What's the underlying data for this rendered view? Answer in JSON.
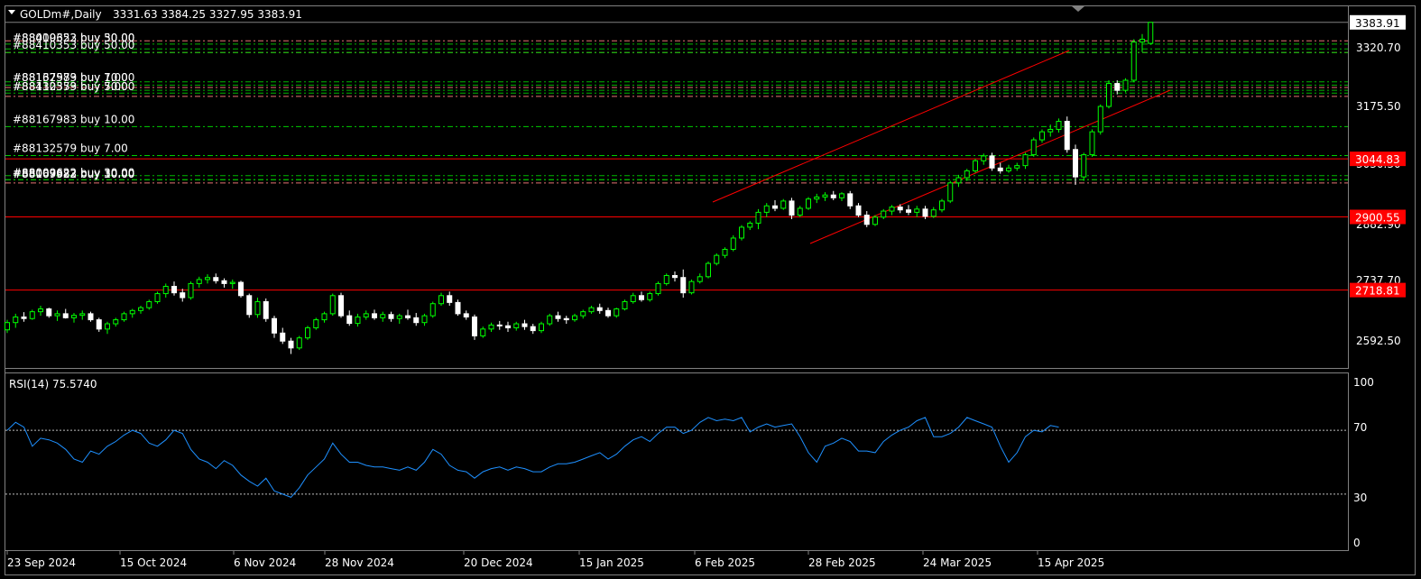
{
  "header": {
    "symbol": "GOLDm#,Daily",
    "ohlc": "3331.63 3384.25 3327.95 3383.91"
  },
  "price_axis": {
    "labels": [
      "3320.70",
      "3175.50",
      "3030.30",
      "2882.90",
      "2737.70",
      "2592.50"
    ],
    "current_price": "3383.91",
    "red_tags": [
      "3044.83",
      "2900.55",
      "2718.81"
    ]
  },
  "rsi": {
    "title": "RSI(14) 75.5740",
    "levels": [
      "100",
      "70",
      "30",
      "0"
    ]
  },
  "date_labels": [
    "23 Sep 2024",
    "15 Oct 2024",
    "6 Nov 2024",
    "28 Nov 2024",
    "20 Dec 2024",
    "15 Jan 2025",
    "6 Feb 2025",
    "28 Feb 2025",
    "24 Mar 2025",
    "15 Apr 2025"
  ],
  "orders": [
    {
      "text": "#88167983 buy 10.00",
      "price": 3125
    },
    {
      "text": "#88132579 buy 7.00",
      "price": 3053
    },
    {
      "text": "#88410353 buy 50.00",
      "price": 3309
    },
    {
      "text": "#88009622 buy 30.00",
      "price": 2993
    }
  ],
  "colors": {
    "bull": "#00ff00",
    "bear": "#ffffff",
    "sr_line": "#ff0000",
    "channel": "#ff0000",
    "rsi_line": "#1e90ff",
    "order_line": "#00cc00",
    "frame": "#808080"
  },
  "chart_data": {
    "type": "candlestick",
    "ylim": [
      2570,
      3410
    ],
    "series": [
      {
        "name": "GOLDm#,Daily",
        "values": [
          [
            2620,
            2645,
            2612,
            2638
          ],
          [
            2638,
            2660,
            2625,
            2652
          ],
          [
            2652,
            2664,
            2640,
            2648
          ],
          [
            2648,
            2670,
            2645,
            2665
          ],
          [
            2665,
            2680,
            2655,
            2672
          ],
          [
            2672,
            2675,
            2650,
            2655
          ],
          [
            2655,
            2668,
            2642,
            2660
          ],
          [
            2660,
            2672,
            2648,
            2650
          ],
          [
            2650,
            2662,
            2638,
            2656
          ],
          [
            2656,
            2668,
            2645,
            2660
          ],
          [
            2660,
            2665,
            2640,
            2645
          ],
          [
            2645,
            2650,
            2615,
            2622
          ],
          [
            2622,
            2640,
            2610,
            2635
          ],
          [
            2635,
            2650,
            2628,
            2645
          ],
          [
            2645,
            2665,
            2640,
            2660
          ],
          [
            2660,
            2672,
            2650,
            2668
          ],
          [
            2668,
            2680,
            2660,
            2675
          ],
          [
            2675,
            2695,
            2670,
            2690
          ],
          [
            2690,
            2715,
            2685,
            2710
          ],
          [
            2710,
            2735,
            2700,
            2728
          ],
          [
            2728,
            2740,
            2705,
            2712
          ],
          [
            2712,
            2722,
            2690,
            2700
          ],
          [
            2700,
            2740,
            2695,
            2735
          ],
          [
            2735,
            2752,
            2725,
            2745
          ],
          [
            2745,
            2758,
            2735,
            2750
          ],
          [
            2750,
            2760,
            2735,
            2742
          ],
          [
            2742,
            2748,
            2725,
            2735
          ],
          [
            2735,
            2745,
            2722,
            2738
          ],
          [
            2738,
            2742,
            2700,
            2705
          ],
          [
            2705,
            2710,
            2650,
            2658
          ],
          [
            2658,
            2700,
            2650,
            2690
          ],
          [
            2690,
            2698,
            2640,
            2648
          ],
          [
            2648,
            2655,
            2600,
            2612
          ],
          [
            2612,
            2625,
            2585,
            2592
          ],
          [
            2592,
            2600,
            2560,
            2575
          ],
          [
            2575,
            2605,
            2570,
            2600
          ],
          [
            2600,
            2630,
            2595,
            2625
          ],
          [
            2625,
            2650,
            2620,
            2645
          ],
          [
            2645,
            2665,
            2638,
            2660
          ],
          [
            2660,
            2710,
            2655,
            2705
          ],
          [
            2705,
            2712,
            2650,
            2655
          ],
          [
            2655,
            2668,
            2630,
            2636
          ],
          [
            2636,
            2660,
            2628,
            2652
          ],
          [
            2652,
            2668,
            2645,
            2660
          ],
          [
            2660,
            2670,
            2645,
            2650
          ],
          [
            2650,
            2665,
            2640,
            2658
          ],
          [
            2658,
            2665,
            2640,
            2648
          ],
          [
            2648,
            2660,
            2635,
            2655
          ],
          [
            2655,
            2670,
            2645,
            2650
          ],
          [
            2650,
            2662,
            2630,
            2638
          ],
          [
            2638,
            2660,
            2630,
            2655
          ],
          [
            2655,
            2690,
            2650,
            2685
          ],
          [
            2685,
            2712,
            2680,
            2705
          ],
          [
            2705,
            2715,
            2680,
            2688
          ],
          [
            2688,
            2695,
            2655,
            2660
          ],
          [
            2660,
            2668,
            2645,
            2652
          ],
          [
            2652,
            2658,
            2595,
            2605
          ],
          [
            2605,
            2628,
            2600,
            2622
          ],
          [
            2622,
            2638,
            2615,
            2632
          ],
          [
            2632,
            2642,
            2620,
            2630
          ],
          [
            2630,
            2640,
            2615,
            2625
          ],
          [
            2625,
            2640,
            2618,
            2635
          ],
          [
            2635,
            2645,
            2620,
            2628
          ],
          [
            2628,
            2635,
            2610,
            2618
          ],
          [
            2618,
            2640,
            2612,
            2635
          ],
          [
            2635,
            2660,
            2630,
            2655
          ],
          [
            2655,
            2665,
            2640,
            2648
          ],
          [
            2648,
            2655,
            2635,
            2645
          ],
          [
            2645,
            2660,
            2640,
            2655
          ],
          [
            2655,
            2670,
            2648,
            2665
          ],
          [
            2665,
            2680,
            2660,
            2675
          ],
          [
            2675,
            2685,
            2660,
            2668
          ],
          [
            2668,
            2675,
            2650,
            2655
          ],
          [
            2655,
            2675,
            2650,
            2672
          ],
          [
            2672,
            2695,
            2668,
            2690
          ],
          [
            2690,
            2712,
            2685,
            2705
          ],
          [
            2705,
            2715,
            2690,
            2695
          ],
          [
            2695,
            2715,
            2690,
            2710
          ],
          [
            2710,
            2740,
            2705,
            2735
          ],
          [
            2735,
            2760,
            2730,
            2755
          ],
          [
            2755,
            2765,
            2740,
            2750
          ],
          [
            2750,
            2770,
            2700,
            2712
          ],
          [
            2712,
            2745,
            2708,
            2740
          ],
          [
            2740,
            2760,
            2735,
            2752
          ],
          [
            2752,
            2790,
            2748,
            2785
          ],
          [
            2785,
            2810,
            2780,
            2805
          ],
          [
            2805,
            2825,
            2798,
            2820
          ],
          [
            2820,
            2855,
            2815,
            2848
          ],
          [
            2848,
            2880,
            2842,
            2875
          ],
          [
            2875,
            2890,
            2868,
            2885
          ],
          [
            2885,
            2920,
            2870,
            2912
          ],
          [
            2912,
            2935,
            2900,
            2928
          ],
          [
            2928,
            2942,
            2915,
            2922
          ],
          [
            2922,
            2945,
            2918,
            2940
          ],
          [
            2940,
            2948,
            2895,
            2905
          ],
          [
            2905,
            2928,
            2900,
            2922
          ],
          [
            2922,
            2950,
            2918,
            2945
          ],
          [
            2945,
            2958,
            2935,
            2950
          ],
          [
            2950,
            2962,
            2940,
            2955
          ],
          [
            2955,
            2965,
            2942,
            2948
          ],
          [
            2948,
            2962,
            2940,
            2958
          ],
          [
            2958,
            2965,
            2920,
            2928
          ],
          [
            2928,
            2935,
            2900,
            2905
          ],
          [
            2905,
            2915,
            2875,
            2882
          ],
          [
            2882,
            2905,
            2878,
            2900
          ],
          [
            2900,
            2920,
            2895,
            2915
          ],
          [
            2915,
            2930,
            2905,
            2925
          ],
          [
            2925,
            2932,
            2910,
            2918
          ],
          [
            2918,
            2930,
            2905,
            2912
          ],
          [
            2912,
            2928,
            2900,
            2920
          ],
          [
            2920,
            2928,
            2895,
            2902
          ],
          [
            2902,
            2925,
            2898,
            2918
          ],
          [
            2918,
            2945,
            2912,
            2940
          ],
          [
            2940,
            2990,
            2935,
            2985
          ],
          [
            2985,
            3005,
            2975,
            2998
          ],
          [
            2998,
            3020,
            2990,
            3015
          ],
          [
            3015,
            3045,
            3010,
            3040
          ],
          [
            3040,
            3058,
            3030,
            3052
          ],
          [
            3052,
            3060,
            3015,
            3022
          ],
          [
            3022,
            3035,
            3008,
            3015
          ],
          [
            3015,
            3030,
            3010,
            3022
          ],
          [
            3022,
            3035,
            3015,
            3028
          ],
          [
            3028,
            3060,
            3020,
            3055
          ],
          [
            3055,
            3098,
            3050,
            3092
          ],
          [
            3092,
            3118,
            3085,
            3112
          ],
          [
            3112,
            3130,
            3100,
            3118
          ],
          [
            3118,
            3145,
            3110,
            3138
          ],
          [
            3138,
            3150,
            3060,
            3068
          ],
          [
            3068,
            3080,
            2980,
            3000
          ],
          [
            3000,
            3060,
            2990,
            3055
          ],
          [
            3055,
            3118,
            3050,
            3112
          ],
          [
            3112,
            3180,
            3105,
            3175
          ],
          [
            3175,
            3240,
            3170,
            3232
          ],
          [
            3232,
            3240,
            3205,
            3215
          ],
          [
            3215,
            3245,
            3210,
            3240
          ],
          [
            3240,
            3342,
            3235,
            3335
          ],
          [
            3335,
            3355,
            3310,
            3342
          ],
          [
            3331.63,
            3384.25,
            3327.95,
            3383.91
          ]
        ]
      },
      {
        "name": "RSI(14)",
        "values": [
          70,
          75,
          72,
          60,
          65,
          64,
          62,
          58,
          52,
          50,
          57,
          55,
          60,
          63,
          67,
          70,
          68,
          62,
          60,
          64,
          70,
          68,
          58,
          52,
          50,
          46,
          51,
          48,
          42,
          38,
          35,
          40,
          32,
          30,
          28,
          34,
          42,
          47,
          52,
          62,
          55,
          50,
          50,
          48,
          47,
          47,
          46,
          45,
          47,
          45,
          50,
          58,
          55,
          48,
          45,
          44,
          40,
          44,
          46,
          47,
          45,
          47,
          46,
          44,
          44,
          47,
          49,
          49,
          50,
          52,
          54,
          56,
          52,
          55,
          60,
          64,
          66,
          63,
          68,
          72,
          72,
          68,
          70,
          75,
          78,
          76,
          77,
          76,
          78,
          69,
          72,
          74,
          72,
          73,
          74,
          66,
          56,
          50,
          60,
          62,
          65,
          63,
          57,
          57,
          56,
          63,
          67,
          70,
          72,
          76,
          78,
          66,
          66,
          68,
          72,
          78,
          76,
          74,
          72,
          60,
          50,
          56,
          66,
          70,
          69,
          73,
          72
        ]
      }
    ]
  }
}
